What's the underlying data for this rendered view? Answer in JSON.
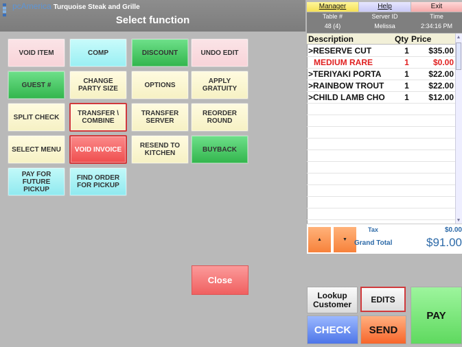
{
  "header": {
    "brand": "pcAmerica",
    "store_name": "Turquoise Steak and Grille",
    "title": "Select function"
  },
  "functions": [
    {
      "label": "VOID ITEM",
      "name": "void-item-button"
    },
    {
      "label": "COMP",
      "name": "comp-button"
    },
    {
      "label": "DISCOUNT",
      "name": "discount-button"
    },
    {
      "label": "UNDO EDIT",
      "name": "undo-edit-button"
    },
    {
      "label": "GUEST #",
      "name": "guest-number-button"
    },
    {
      "label": "CHANGE PARTY SIZE",
      "name": "change-party-size-button"
    },
    {
      "label": "OPTIONS",
      "name": "options-button"
    },
    {
      "label": "APPLY GRATUITY",
      "name": "apply-gratuity-button"
    },
    {
      "label": "SPLIT CHECK",
      "name": "split-check-button"
    },
    {
      "label": "TRANSFER \\ COMBINE",
      "name": "transfer-combine-button"
    },
    {
      "label": "TRANSFER SERVER",
      "name": "transfer-server-button"
    },
    {
      "label": "REORDER ROUND",
      "name": "reorder-round-button"
    },
    {
      "label": "SELECT MENU",
      "name": "select-menu-button"
    },
    {
      "label": "VOID INVOICE",
      "name": "void-invoice-button"
    },
    {
      "label": "RESEND TO KITCHEN",
      "name": "resend-to-kitchen-button"
    },
    {
      "label": "BUYBACK",
      "name": "buyback-button"
    },
    {
      "label": "PAY FOR FUTURE PICKUP",
      "name": "pay-for-future-pickup-button"
    },
    {
      "label": "FIND ORDER FOR PICKUP",
      "name": "find-order-for-pickup-button"
    }
  ],
  "close_label": "Close",
  "top_buttons": {
    "manager": "Manager",
    "help": "Help",
    "exit": "Exit"
  },
  "info": {
    "table_label": "Table #",
    "table_value": "48 (4)",
    "server_label": "Server ID",
    "server_value": "Melissa",
    "time_label": "Time",
    "time_value": "2:34:16 PM"
  },
  "order": {
    "headers": {
      "description": "Description",
      "qty": "Qty",
      "price": "Price"
    },
    "rows": [
      {
        "description": ">RESERVE CUT",
        "qty": "1",
        "price": "$35.00",
        "modifier": false
      },
      {
        "description": "MEDIUM RARE",
        "qty": "1",
        "price": "$0.00",
        "modifier": true
      },
      {
        "description": ">TERIYAKI PORTA",
        "qty": "1",
        "price": "$22.00",
        "modifier": false
      },
      {
        "description": ">RAINBOW TROUT",
        "qty": "1",
        "price": "$22.00",
        "modifier": false
      },
      {
        "description": ">CHILD LAMB CHO",
        "qty": "1",
        "price": "$12.00",
        "modifier": false
      }
    ]
  },
  "totals": {
    "tax_label": "Tax",
    "tax_value": "$0.00",
    "grand_total_label": "Grand Total",
    "grand_total_value": "$91.00"
  },
  "actions": {
    "lookup": "Lookup Customer",
    "edits": "EDITS",
    "pay": "PAY",
    "check": "CHECK",
    "send": "SEND"
  }
}
